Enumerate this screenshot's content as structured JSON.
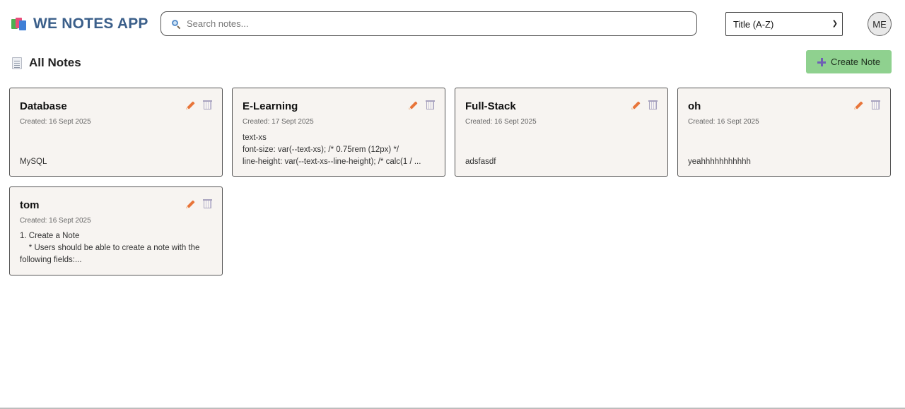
{
  "app": {
    "title": "WE NOTES APP"
  },
  "search": {
    "placeholder": "Search notes..."
  },
  "sort": {
    "selected": "Title (A-Z)"
  },
  "user": {
    "initials": "ME"
  },
  "section": {
    "title": "All Notes"
  },
  "actions": {
    "create_label": "Create Note"
  },
  "notes": [
    {
      "title": "Database",
      "created": "Created: 16 Sept 2025",
      "body": "MySQL"
    },
    {
      "title": "E-Learning",
      "created": "Created: 17 Sept 2025",
      "body": "text-xs\nfont-size: var(--text-xs); /* 0.75rem (12px) */\nline-height: var(--text-xs--line-height); /* calc(1 / ..."
    },
    {
      "title": "Full-Stack",
      "created": "Created: 16 Sept 2025",
      "body": "adsfasdf"
    },
    {
      "title": "oh",
      "created": "Created: 16 Sept 2025",
      "body": "yeahhhhhhhhhhh"
    },
    {
      "title": "tom",
      "created": "Created: 16 Sept 2025",
      "body": "1. Create a Note\n    * Users should be able to create a note with the following fields:..."
    }
  ],
  "colors": {
    "brand": "#3b5f8a",
    "create_button": "#8fd18f",
    "card_background": "#f7f4f1",
    "edit_icon": "#e8753a",
    "trash_icon": "#a8a3be"
  },
  "icons": {
    "logo": "books-icon",
    "search": "search-icon",
    "section": "document-icon",
    "create": "plus-icon",
    "edit": "pencil-icon",
    "delete": "trash-icon"
  }
}
